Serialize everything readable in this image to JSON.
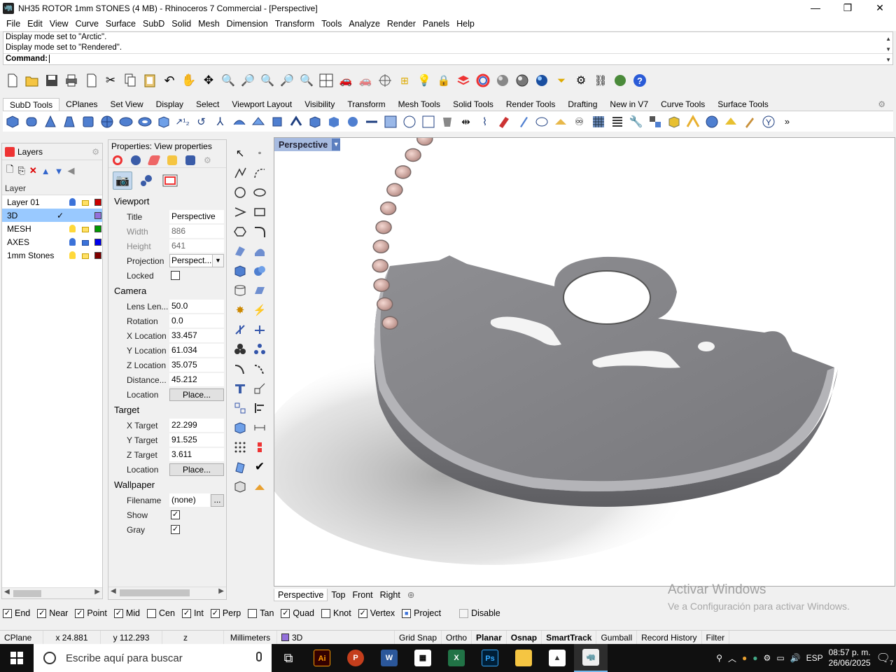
{
  "window": {
    "title": "NH35 ROTOR 1mm STONES (4 MB) - Rhinoceros 7 Commercial - [Perspective]",
    "minimize": "—",
    "restore": "❐",
    "close": "✕"
  },
  "menu": [
    "File",
    "Edit",
    "View",
    "Curve",
    "Surface",
    "SubD",
    "Solid",
    "Mesh",
    "Dimension",
    "Transform",
    "Tools",
    "Analyze",
    "Render",
    "Panels",
    "Help"
  ],
  "command": {
    "history": [
      "Display mode set to \"Arctic\".",
      "Display mode set to \"Rendered\"."
    ],
    "prompt": "Command:",
    "value": ""
  },
  "toolbar_tabs": [
    "SubD Tools",
    "CPlanes",
    "Set View",
    "Display",
    "Select",
    "Viewport Layout",
    "Visibility",
    "Transform",
    "Mesh Tools",
    "Solid Tools",
    "Render Tools",
    "Drafting",
    "New in V7",
    "Curve Tools",
    "Surface Tools"
  ],
  "toolbar_tabs_active": "SubD Tools",
  "layers": {
    "title": "Layers",
    "column": "Layer",
    "items": [
      {
        "name": "Layer 01",
        "current": false,
        "visible": true,
        "locked": false,
        "color": "#cc0000",
        "selected": false
      },
      {
        "name": "3D",
        "current": true,
        "visible": true,
        "locked": false,
        "color": "#9370db",
        "selected": true
      },
      {
        "name": "MESH",
        "current": false,
        "visible": true,
        "locked": false,
        "color": "#009900",
        "selected": false
      },
      {
        "name": "AXES",
        "current": false,
        "visible": true,
        "locked": true,
        "color": "#0000ee",
        "selected": false
      },
      {
        "name": "1mm Stones",
        "current": false,
        "visible": true,
        "locked": false,
        "color": "#800000",
        "selected": false
      }
    ],
    "current_mark": "✓"
  },
  "properties": {
    "title": "Properties: View properties",
    "viewport": {
      "heading": "Viewport",
      "title_label": "Title",
      "title": "Perspective",
      "width_label": "Width",
      "width": "886",
      "height_label": "Height",
      "height": "641",
      "projection_label": "Projection",
      "projection": "Perspect...",
      "locked_label": "Locked",
      "locked": ""
    },
    "camera": {
      "heading": "Camera",
      "lens_label": "Lens Len...",
      "lens": "50.0",
      "rotation_label": "Rotation",
      "rotation": "0.0",
      "x_label": "X Location",
      "x": "33.457",
      "y_label": "Y Location",
      "y": "61.034",
      "z_label": "Z Location",
      "z": "35.075",
      "dist_label": "Distance...",
      "dist": "45.212",
      "loc_label": "Location",
      "loc_btn": "Place..."
    },
    "target": {
      "heading": "Target",
      "x_label": "X Target",
      "x": "22.299",
      "y_label": "Y Target",
      "y": "91.525",
      "z_label": "Z Target",
      "z": "3.611",
      "loc_label": "Location",
      "loc_btn": "Place..."
    },
    "wallpaper": {
      "heading": "Wallpaper",
      "file_label": "Filename",
      "file": "(none)",
      "browse": "...",
      "show_label": "Show",
      "show": "✓",
      "gray_label": "Gray",
      "gray": "✓"
    }
  },
  "viewport": {
    "name": "Perspective",
    "dropdown": "▼"
  },
  "viewport_tabs": [
    "Perspective",
    "Top",
    "Front",
    "Right"
  ],
  "viewport_tabs_add": "⊕",
  "watermark": {
    "line1": "Activar Windows",
    "line2": "Ve a Configuración para activar Windows."
  },
  "osnaps": [
    {
      "label": "End",
      "checked": true
    },
    {
      "label": "Near",
      "checked": true
    },
    {
      "label": "Point",
      "checked": true
    },
    {
      "label": "Mid",
      "checked": true
    },
    {
      "label": "Cen",
      "checked": false
    },
    {
      "label": "Int",
      "checked": true
    },
    {
      "label": "Perp",
      "checked": true
    },
    {
      "label": "Tan",
      "checked": false
    },
    {
      "label": "Quad",
      "checked": true
    },
    {
      "label": "Knot",
      "checked": false
    },
    {
      "label": "Vertex",
      "checked": true
    },
    {
      "label": "Project",
      "checked": true
    },
    {
      "label": "Disable",
      "checked": false
    }
  ],
  "status": {
    "cplane": "CPlane",
    "x": "x 24.881",
    "y": "y 112.293",
    "z": "z",
    "units": "Millimeters",
    "layer": "3D",
    "grid_snap": "Grid Snap",
    "ortho": "Ortho",
    "planar": "Planar",
    "osnap": "Osnap",
    "smarttrack": "SmartTrack",
    "gumball": "Gumball",
    "record_history": "Record History",
    "filter": "Filter"
  },
  "taskbar": {
    "search_placeholder": "Escribe aquí para buscar",
    "time": "08:57 p. m.",
    "date": "26/06/2025",
    "lang": "ESP",
    "notif": "7"
  }
}
